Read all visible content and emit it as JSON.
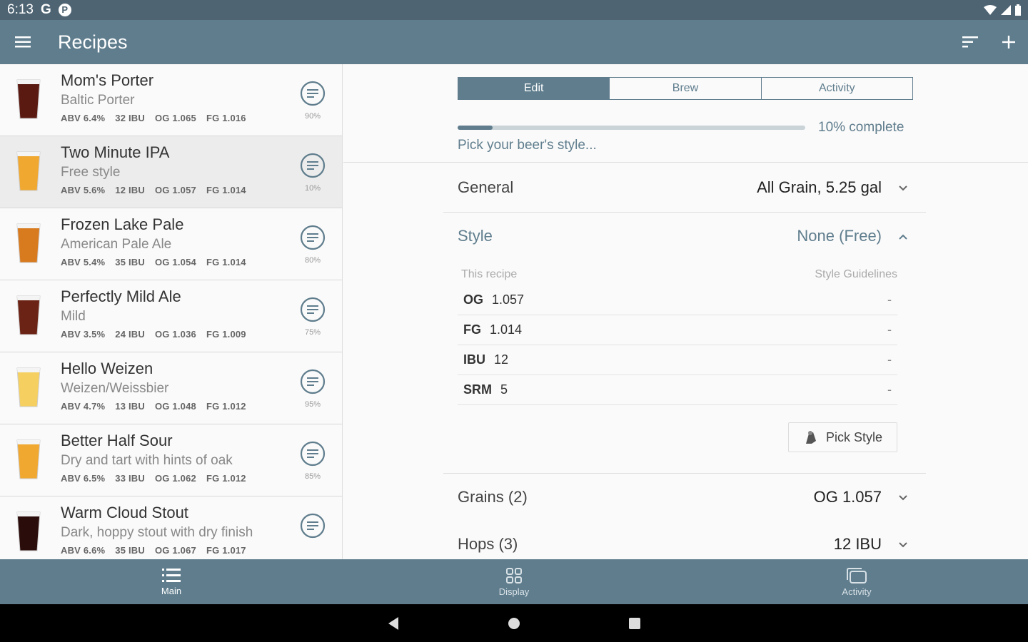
{
  "status": {
    "time": "6:13",
    "app_icons": [
      "G",
      "P"
    ]
  },
  "appbar": {
    "title": "Recipes",
    "menu_icon": "hamburger-icon",
    "sort_icon": "sort-icon",
    "add_icon": "plus-icon"
  },
  "recipes": [
    {
      "name": "Mom's Porter",
      "style": "Baltic Porter",
      "abv": "ABV 6.4%",
      "ibu": "32 IBU",
      "og": "OG 1.065",
      "fg": "FG 1.016",
      "progress": "90%",
      "color": "#5a1a12"
    },
    {
      "name": "Two Minute IPA",
      "style": "Free style",
      "abv": "ABV 5.6%",
      "ibu": "12 IBU",
      "og": "OG 1.057",
      "fg": "FG 1.014",
      "progress": "10%",
      "color": "#f0a830"
    },
    {
      "name": "Frozen Lake Pale",
      "style": "American Pale Ale",
      "abv": "ABV 5.4%",
      "ibu": "35 IBU",
      "og": "OG 1.054",
      "fg": "FG 1.014",
      "progress": "80%",
      "color": "#d87a1e"
    },
    {
      "name": "Perfectly Mild Ale",
      "style": "Mild",
      "abv": "ABV 3.5%",
      "ibu": "24 IBU",
      "og": "OG 1.036",
      "fg": "FG 1.009",
      "progress": "75%",
      "color": "#6b2315"
    },
    {
      "name": "Hello Weizen",
      "style": "Weizen/Weissbier",
      "abv": "ABV 4.7%",
      "ibu": "13 IBU",
      "og": "OG 1.048",
      "fg": "FG 1.012",
      "progress": "95%",
      "color": "#f5d060"
    },
    {
      "name": "Better Half Sour",
      "style": "Dry and tart with hints of oak",
      "abv": "ABV 6.5%",
      "ibu": "33 IBU",
      "og": "OG 1.062",
      "fg": "FG 1.012",
      "progress": "85%",
      "color": "#f0a830"
    },
    {
      "name": "Warm Cloud Stout",
      "style": "Dark, hoppy stout with dry finish",
      "abv": "ABV 6.6%",
      "ibu": "35 IBU",
      "og": "OG 1.067",
      "fg": "FG 1.017",
      "progress": "",
      "color": "#2a0c0a"
    }
  ],
  "detail": {
    "tabs": [
      "Edit",
      "Brew",
      "Activity"
    ],
    "progress_fraction": 0.1,
    "progress_label": "10% complete",
    "hint": "Pick your beer's style...",
    "general": {
      "label": "General",
      "value": "All Grain, 5.25 gal"
    },
    "style": {
      "label": "Style",
      "value": "None (Free)"
    },
    "style_table": {
      "col1": "This recipe",
      "col2": "Style Guidelines",
      "rows": [
        {
          "k": "OG",
          "v": "1.057",
          "g": "-"
        },
        {
          "k": "FG",
          "v": "1.014",
          "g": "-"
        },
        {
          "k": "IBU",
          "v": "12",
          "g": "-"
        },
        {
          "k": "SRM",
          "v": "5",
          "g": "-"
        }
      ]
    },
    "pick_style": "Pick Style",
    "grains": {
      "label": "Grains (2)",
      "value": "OG 1.057"
    },
    "hops": {
      "label": "Hops (3)",
      "value": "12 IBU"
    }
  },
  "bottomnav": [
    {
      "label": "Main",
      "icon": "list-icon"
    },
    {
      "label": "Display",
      "icon": "grid-icon"
    },
    {
      "label": "Activity",
      "icon": "activity-icon"
    }
  ]
}
